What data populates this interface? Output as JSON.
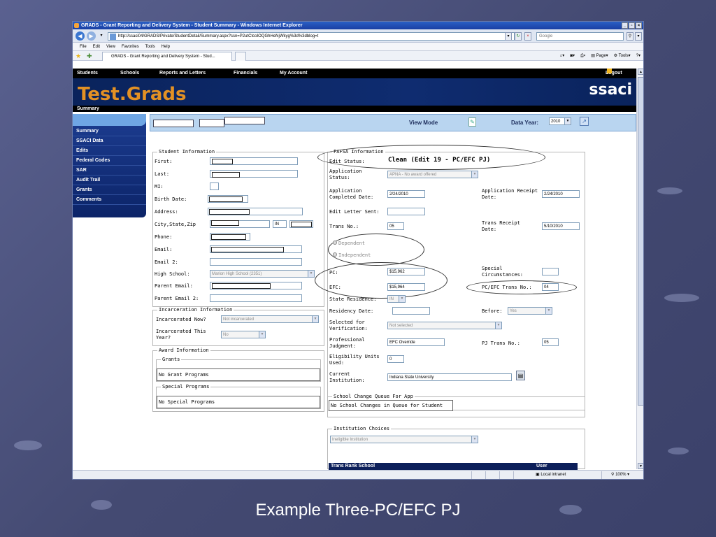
{
  "browser": {
    "title": "GRADS - Grant Reporting and Delivery System - Student Summary - Windows Internet Explorer",
    "url": "http://ssaci04/GRADS/Private/StudentDetail/Summary.aspx?ssn=P2utCtcoIOQGhHeNjWkyg%3d%3dblog=t",
    "search_placeholder": "Google",
    "menu": [
      "File",
      "Edit",
      "View",
      "Favorites",
      "Tools",
      "Help"
    ],
    "tab_title": "GRADS - Grant Reporting and Delivery System - Stud...",
    "cmd_page": "Page",
    "cmd_tools": "Tools",
    "status_zone": "Local intranet",
    "zoom": "100%"
  },
  "appnav": {
    "items": [
      "Students",
      "Schools",
      "Reports and Letters",
      "Financials",
      "My Account"
    ],
    "logout": "Logout"
  },
  "banner": {
    "logo": "Test.Grads",
    "brand": "ssaci",
    "breadcrumb": "Summary"
  },
  "sidebar": {
    "items": [
      "Summary",
      "SSACI Data",
      "Edits",
      "Federal Codes",
      "SAR",
      "Audit Trail",
      "Grants",
      "Comments"
    ]
  },
  "infobar": {
    "view_mode": "View Mode",
    "data_year_label": "Data Year:",
    "data_year": "2010"
  },
  "student": {
    "legend": "Student Information",
    "first": "First:",
    "last": "Last:",
    "mi": "MI:",
    "birth_date": "Birth Date:",
    "address": "Address:",
    "city_state_zip": "City,State,Zip",
    "state_value": "IN",
    "phone": "Phone:",
    "email": "Email:",
    "email2": "Email 2:",
    "high_school": "High School:",
    "high_school_value": "Marion High School (2351)",
    "parent_email": "Parent Email:",
    "parent_email2": "Parent Email 2:"
  },
  "incarceration": {
    "legend": "Incarceration Information",
    "now_label": "Incarcerated Now?",
    "now_value": "Not incarcerated",
    "year_label": "Incarcerated This Year?",
    "year_value": "No"
  },
  "award": {
    "legend": "Award Information",
    "grants_legend": "Grants",
    "grants_value": "No Grant Programs",
    "special_legend": "Special Programs",
    "special_value": "No Special Programs"
  },
  "fafsa": {
    "legend": "FAFSA Information",
    "edit_status_label": "Edit Status:",
    "edit_status_value": "Clean (Edit 19 - PC/EFC PJ)",
    "app_status_label": "Application Status:",
    "app_status_value": "APNA - No award offered",
    "app_completed_label": "Application Completed Date:",
    "app_completed_value": "2/24/2010",
    "app_receipt_label": "Application Receipt Date:",
    "app_receipt_value": "2/24/2010",
    "edit_letter_label": "Edit Letter Sent:",
    "trans_no_label": "Trans No.:",
    "trans_no_value": "05",
    "trans_receipt_label": "Trans Receipt Date:",
    "trans_receipt_value": "5/10/2010",
    "dependent": "Dependent",
    "independent": "Independent",
    "pc_label": "PC:",
    "pc_value": "$15,962",
    "special_circ_label": "Special Circumstances:",
    "efc_label": "EFC:",
    "efc_value": "$15,964",
    "pc_efc_trans_label": "PC/EFC Trans No.:",
    "pc_efc_trans_value": "04",
    "state_residence_label": "State Residence:",
    "state_residence_value": "IN",
    "residency_date_label": "Residency Date:",
    "before_label": "Before:",
    "before_value": "Yes",
    "selected_verif_label": "Selected for Verification:",
    "selected_verif_value": "Not selected",
    "prof_judgment_label": "Professional Judgment:",
    "prof_judgment_value": "EFC Override",
    "pj_trans_label": "PJ Trans No.:",
    "pj_trans_value": "05",
    "elig_units_label": "Eligibility Units Used:",
    "elig_units_value": "0",
    "current_inst_label": "Current Institution:",
    "current_inst_value": "Indiana State University"
  },
  "school_change": {
    "legend": "School Change Queue For App",
    "value": "No School Changes in Queue for Student"
  },
  "institution": {
    "legend": "Institution Choices",
    "value": "Ineligible Institution",
    "table_header": "Trans Rank School",
    "table_header_right": "User"
  },
  "caption": "Example Three-PC/EFC PJ"
}
